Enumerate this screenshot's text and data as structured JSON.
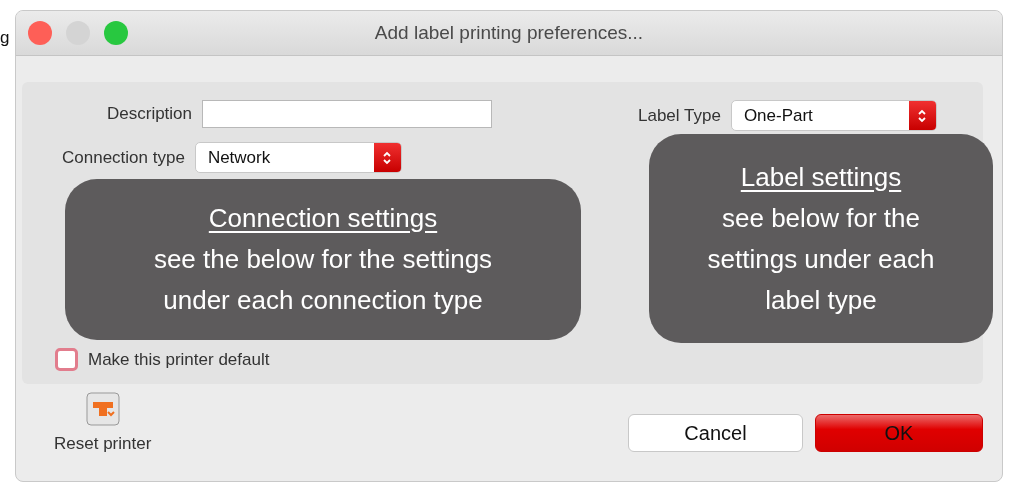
{
  "edge_fragment": "g",
  "window": {
    "title": "Add label printing preferences..."
  },
  "description": {
    "label": "Description"
  },
  "connection_type": {
    "label": "Connection type",
    "value": "Network"
  },
  "connection_overlay": {
    "title": "Connection settings",
    "lines": [
      "see the below for the settings",
      "under each connection type"
    ]
  },
  "make_default": {
    "label": "Make this printer default",
    "checked": false
  },
  "label_type": {
    "label": "Label Type",
    "value": "One-Part"
  },
  "label_overlay": {
    "title": "Label settings",
    "lines": [
      "see below for the",
      "settings under each",
      "label type"
    ]
  },
  "reset_printer": {
    "label": "Reset printer"
  },
  "buttons": [
    {
      "label": "Cancel",
      "kind": "cancel"
    },
    {
      "label": "OK",
      "kind": "default"
    }
  ]
}
